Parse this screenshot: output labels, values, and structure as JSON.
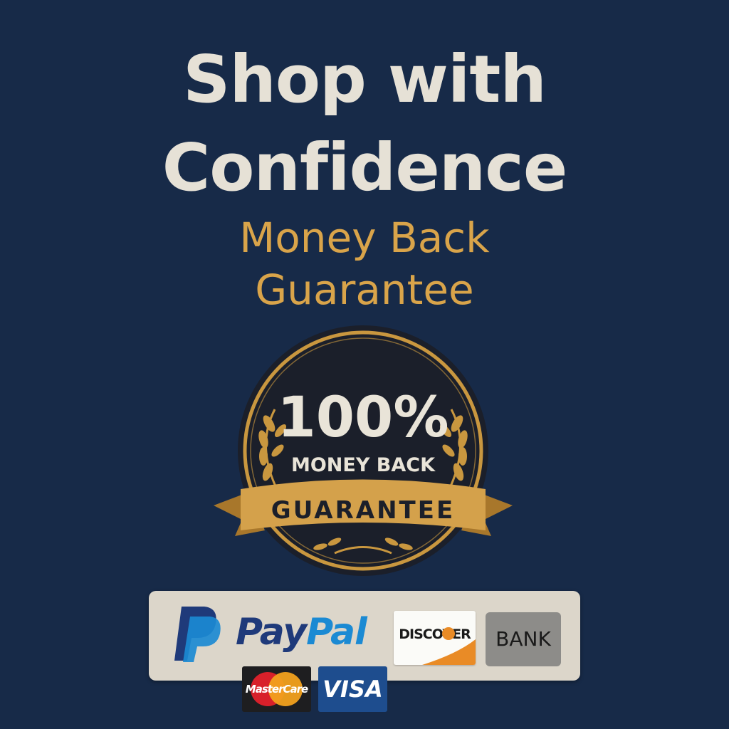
{
  "headline": {
    "line1": "Shop with",
    "line2": "Confidence"
  },
  "subheadline": {
    "line1": "Money Back",
    "line2": "Guarantee"
  },
  "seal": {
    "percent": "100%",
    "text": "MONEY BACK",
    "ribbon": "GUARANTEE",
    "colors": {
      "gold": "#c9973f",
      "dark": "#1b1f2a"
    }
  },
  "payments": {
    "paypal": {
      "pay": "Pay",
      "pal": "Pal",
      "icon": "paypal-logo"
    },
    "discover": {
      "label": "DISCOVER"
    },
    "bank": {
      "label": "BANK"
    },
    "mastercard": {
      "label": "MasterCare"
    },
    "visa": {
      "label": "VISA"
    }
  },
  "colors": {
    "background": "#172a48",
    "headline": "#e6e1d6",
    "accent": "#d9a44a",
    "panel": "#dcd6ca"
  }
}
